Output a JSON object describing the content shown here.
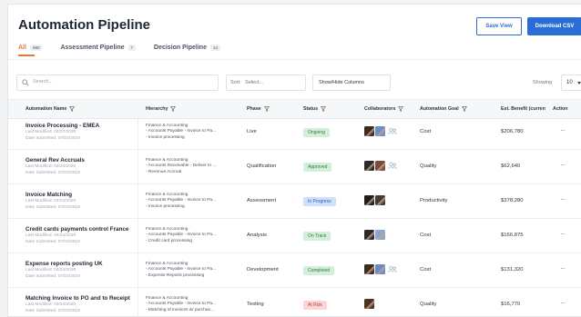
{
  "header": {
    "title": "Automation Pipeline",
    "save_view_label": "Save View",
    "download_label": "Download CSV"
  },
  "tabs": [
    {
      "label": "All",
      "count": "980",
      "active": true
    },
    {
      "label": "Assessment Pipeline",
      "count": "7",
      "active": false
    },
    {
      "label": "Decision Pipeline",
      "count": "14",
      "active": false
    }
  ],
  "toolbar": {
    "search_placeholder": "Search...",
    "sort_label": "Sort:",
    "sort_value": "Select...",
    "show_hide_label": "Show/Hide Columns",
    "showing_label": "Showing",
    "per_page": "10"
  },
  "columns": {
    "name": "Automation Name",
    "hierarchy": "Hierarchy",
    "phase": "Phase",
    "status": "Status",
    "collaborators": "Collaborators",
    "goal": "Automation Goal",
    "benefit": "Est. Benefit (curren",
    "action": "Action"
  },
  "colors": {
    "accent": "#2b6dd6",
    "active_tab": "#e07a38",
    "status_green_bg": "#d4efd9",
    "status_blue_bg": "#cfe0fb",
    "status_red_bg": "#fbd6d6"
  },
  "rows": [
    {
      "name": "Invoice Processing - EMEA",
      "last_modified": "Last Modified: 04/27/2020",
      "submitted": "Date Submitted: 07/03/2019",
      "hierarchy": [
        "Finance & Accounting",
        "- Accounts Payable - Invoice to Pa...",
        "- Invoice processing"
      ],
      "phase": "Live",
      "status": "Ongoing",
      "status_color": "green",
      "collaborators": 2,
      "extra_icon": true,
      "goal": "Cost",
      "benefit": "$206,780"
    },
    {
      "name": "General Rev Accruals",
      "last_modified": "Last Modified: 04/24/2020",
      "submitted": "Date Submitted: 07/03/2019",
      "hierarchy": [
        "Finance & Accounting",
        "- Accounts Receivable - Deliver to ...",
        "- Revenue Accrual"
      ],
      "phase": "Qualification",
      "status": "Approved",
      "status_color": "green",
      "collaborators": 2,
      "extra_icon": true,
      "goal": "Quality",
      "benefit": "$62,640"
    },
    {
      "name": "Invoice Matching",
      "last_modified": "Last Modified: 04/24/2020",
      "submitted": "Date Submitted: 07/03/2019",
      "hierarchy": [
        "Finance & Accounting",
        "- Accounts Payable - Invoice to Pa...",
        "- Invoice processing"
      ],
      "phase": "Assessment",
      "status": "In Progress",
      "status_color": "blue",
      "collaborators": 2,
      "extra_icon": false,
      "goal": "Productivity",
      "benefit": "$378,280"
    },
    {
      "name": "Credit cards payments control France",
      "last_modified": "Last Modified: 04/24/2020",
      "submitted": "Date Submitted: 07/03/2019",
      "hierarchy": [
        "Finance & Accounting",
        "- Accounts Payable - Invoice to Pa...",
        "- Credit card processing"
      ],
      "phase": "Analysis",
      "status": "On Track",
      "status_color": "green",
      "collaborators": 2,
      "extra_icon": false,
      "goal": "Cost",
      "benefit": "$166,875"
    },
    {
      "name": "Expense reports posting UK",
      "last_modified": "Last Modified: 04/24/2020",
      "submitted": "Date Submitted: 07/03/2019",
      "hierarchy": [
        "Finance & Accounting",
        "- Accounts Payable - Invoice to Pa...",
        "- Expense Reports processing"
      ],
      "phase": "Development",
      "status": "Completed",
      "status_color": "green",
      "collaborators": 2,
      "extra_icon": true,
      "goal": "Cost",
      "benefit": "$131,320"
    },
    {
      "name": "Matching Invoice to PO and to Receipt",
      "last_modified": "Last Modified: 04/24/2020",
      "submitted": "Date Submitted: 07/03/2019",
      "hierarchy": [
        "Finance & Accounting",
        "- Accounts Payable - Invoice to Pa...",
        "- Matching of invoices w/ purchas..."
      ],
      "phase": "Testing",
      "status": "At Risk",
      "status_color": "red",
      "collaborators": 1,
      "extra_icon": false,
      "goal": "Quality",
      "benefit": "$16,770"
    }
  ]
}
